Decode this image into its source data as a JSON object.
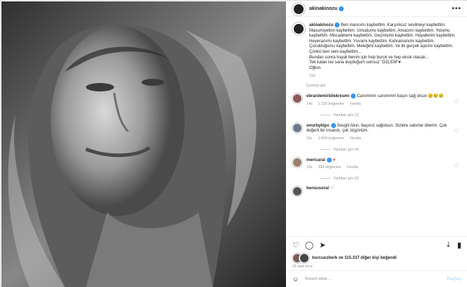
{
  "post": {
    "username": "akinakinozu",
    "caption": "Ben inancımı kaybettim. Karşılıksız sevilmeyi kaybettim. Masumiyetimi kaybettim. Umudumu kaybettim. Amacımı kaybettim. Yolumu kaybettim. Mücadelemi kaybettim. Geçmişimi kaybettim. Hayallerini kaybettim. Heyecanımı kaybettim. Yuvamı kaybettim. Kahramanımı kaybettim. Çocukluğumu kaybettim. Meleğimi kaybettim. Ve ilk gerçek aşkımı kaybettim.\nÇünkü ben seni kaybettim...\nBundan sonra hayat benim için hep buruk ve hep eksik olacak...\nTek kalan ise sana duyduğum sonsuz \"ÖZLEM\"♥\nOğlun",
    "caption_age": "15s",
    "see_translation": "Çeviriyi gör"
  },
  "comments": [
    {
      "username": "ebrardemirbilekresmi",
      "text": "Canımmm canımmm başın sağ olsun 😢😢😢",
      "age": "14s",
      "likes": "1.235 beğenme",
      "reply": "Yanıtla",
      "replies": "Yanıtları gör (3)"
    },
    {
      "username": "onurbyktpc",
      "text": "Sevgili Akın, başınız sağolsun. Sizlere sabırlar dilerim. Çok değerli bir insandı, çok üzgünüm.",
      "age": "15s",
      "likes": "1.493 beğenme",
      "reply": "Yanıtla",
      "replies": "Yanıtları gör (4)"
    },
    {
      "username": "mericaral",
      "text": "♥",
      "age": "13s",
      "likes": "394 beğenme",
      "reply": "Yanıtla",
      "replies": "Yanıtları gör (2)"
    },
    {
      "username": "bensusoral",
      "text": "♡",
      "age": "",
      "likes": "",
      "reply": "",
      "replies": ""
    }
  ],
  "likes_line": {
    "user": "burcuozberk",
    "rest": "ve 115.337 diğer kişi beğendi"
  },
  "post_time": "15 saat önce",
  "add_comment": {
    "placeholder": "Yorum ekle...",
    "post_label": "Paylaş"
  },
  "colors": {
    "verified": "#3897f0",
    "heart": "#ed4956",
    "link_disabled": "#b2dffc"
  }
}
